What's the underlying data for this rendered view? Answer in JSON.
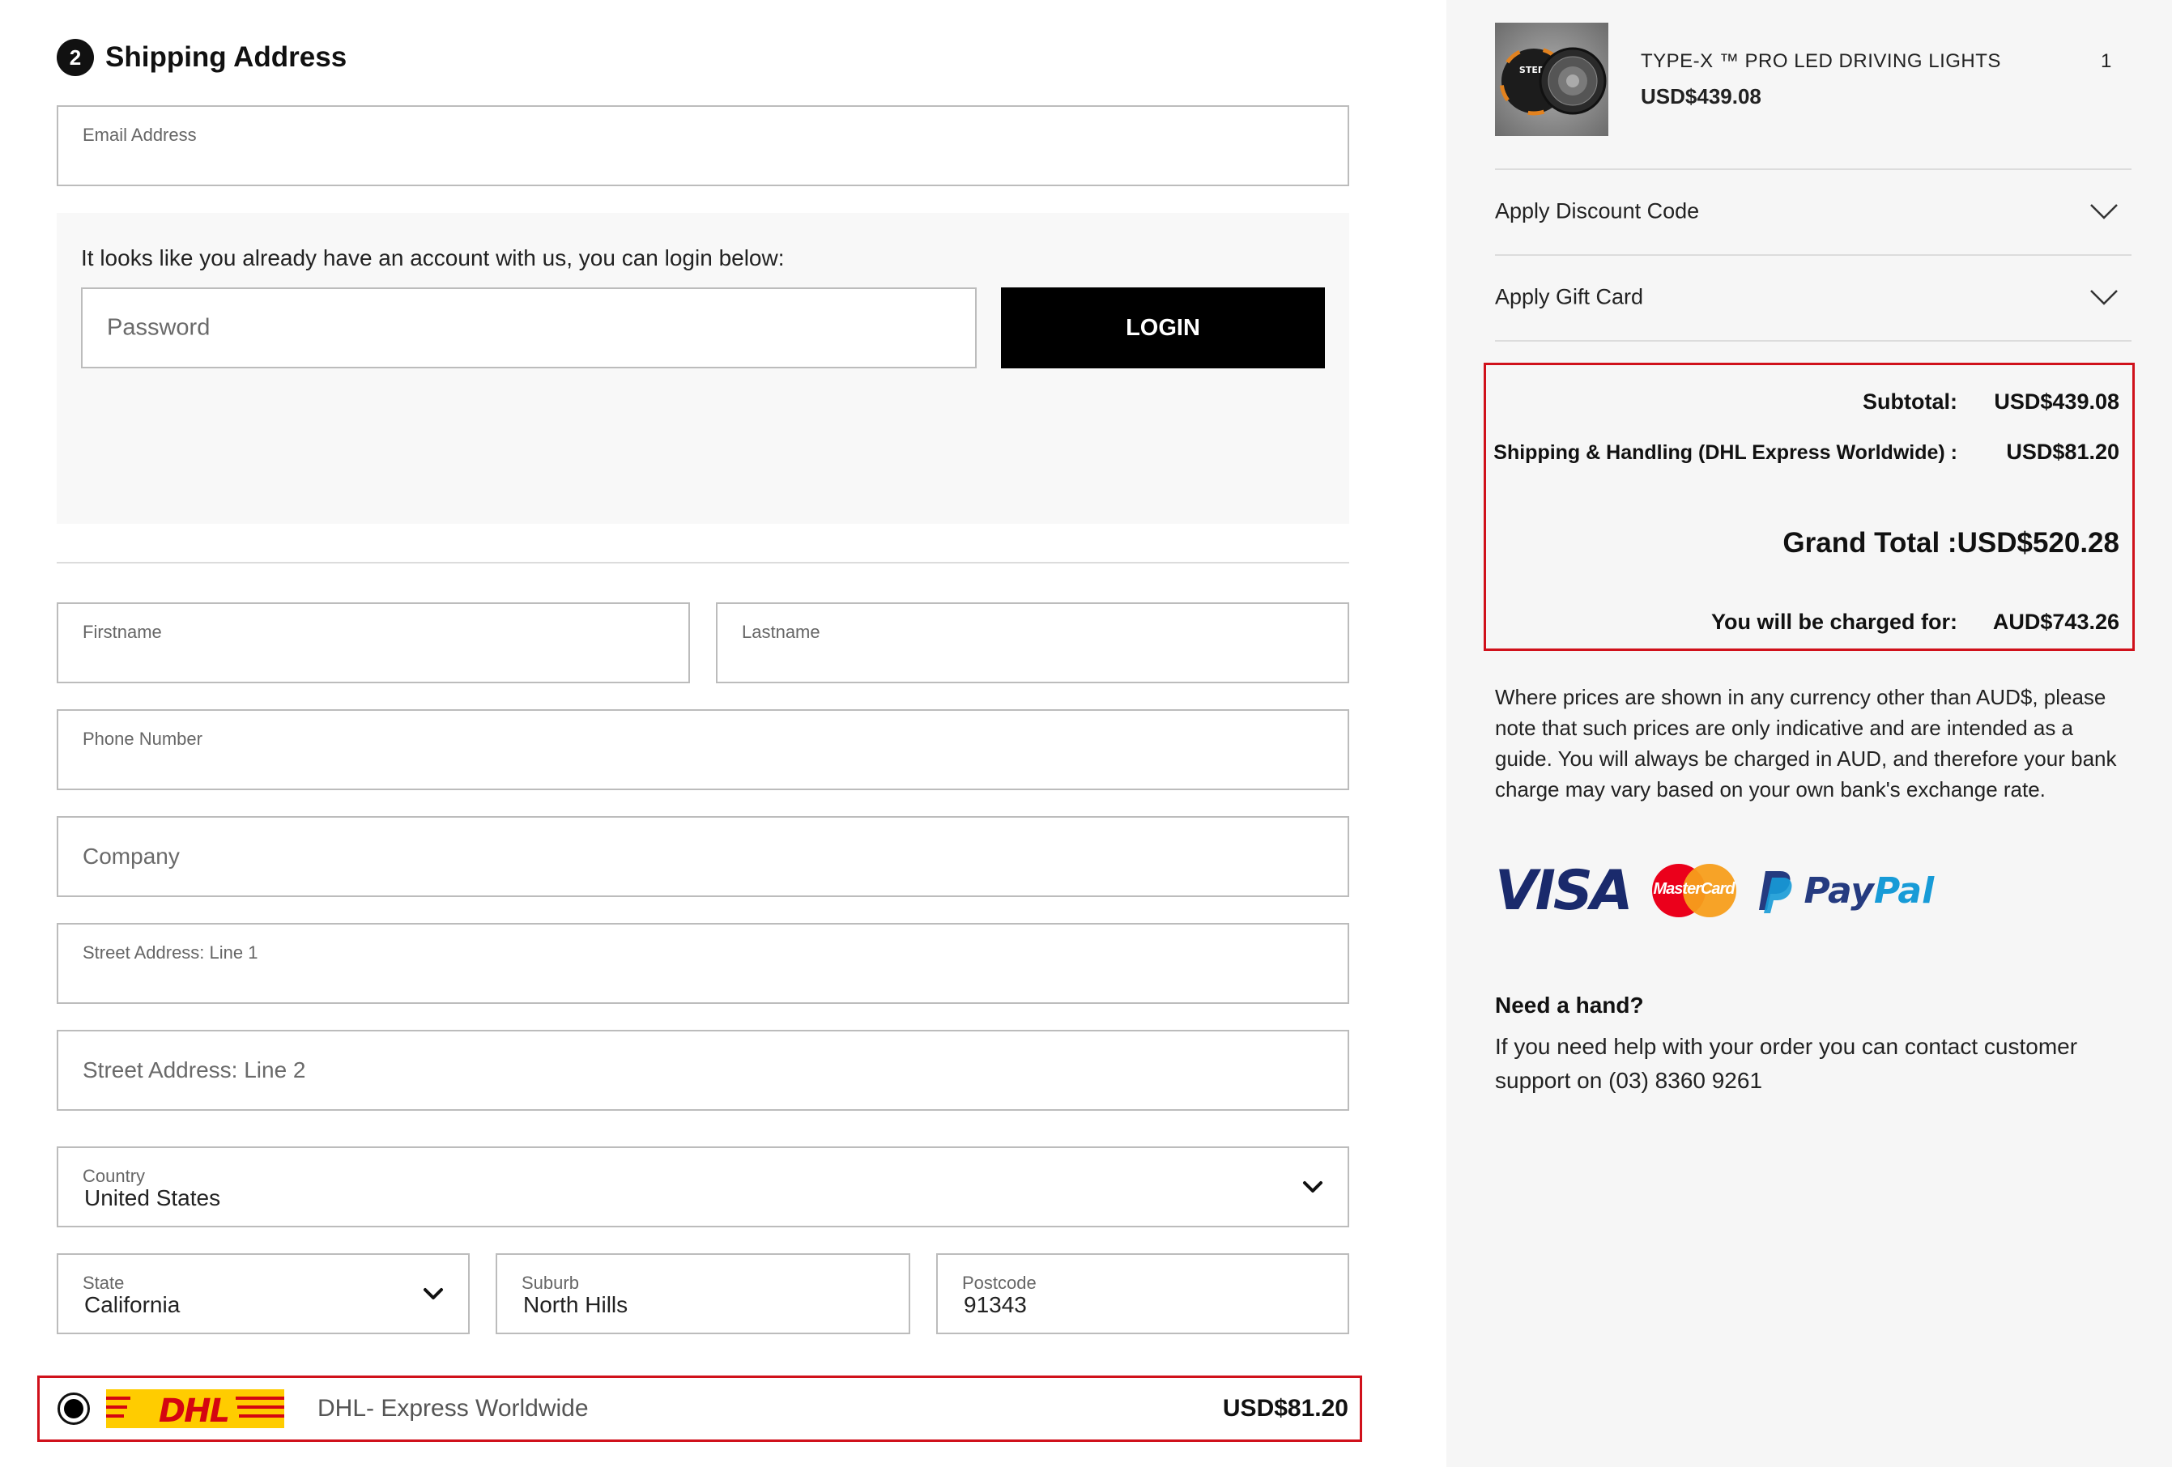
{
  "shipping": {
    "step_number": "2",
    "title": "Shipping Address",
    "email_label": "Email Address",
    "account_message": "It looks like you already have an account with us, you can login below:",
    "password_placeholder": "Password",
    "login_label": "LOGIN",
    "firstname_label": "Firstname",
    "lastname_label": "Lastname",
    "phone_label": "Phone Number",
    "company_placeholder": "Company",
    "street1_label": "Street Address: Line 1",
    "street2_placeholder": "Street Address: Line 2",
    "country_label": "Country",
    "country_value": "United States",
    "state_label": "State",
    "state_value": "California",
    "suburb_label": "Suburb",
    "suburb_value": "North Hills",
    "postcode_label": "Postcode",
    "postcode_value": "91343",
    "option": {
      "carrier_logo_text": "DHL",
      "name": "DHL- Express Worldwide",
      "price": "USD$81.20",
      "selected": true
    }
  },
  "cart": {
    "product": {
      "name": "TYPE-X ™ PRO LED DRIVING LIGHTS",
      "price": "USD$439.08",
      "qty": "1",
      "image_brand_text": "STEDI"
    },
    "discount_label": "Apply Discount Code",
    "giftcard_label": "Apply Gift Card",
    "totals": {
      "subtotal_label": "Subtotal:",
      "subtotal_value": "USD$439.08",
      "shipping_label": "Shipping & Handling (DHL Express Worldwide) :",
      "shipping_value": "USD$81.20",
      "grand_label": "Grand Total :",
      "grand_value": "USD$520.28",
      "charged_label": "You will be charged for:",
      "charged_value": "AUD$743.26"
    },
    "disclaimer": "Where prices are shown in any currency other than AUD$, please note that such prices are only indicative and are intended as a guide. You will always be charged in AUD, and therefore your bank charge may vary based on your own bank's exchange rate.",
    "payment": {
      "visa": "VISA",
      "mastercard": "MasterCard",
      "paypal_pay": "Pay",
      "paypal_pal": "Pal"
    },
    "help_title": "Need a hand?",
    "help_text": "If you need help with your order you can contact customer support on (03) 8360 9261"
  },
  "colors": {
    "highlight": "#d0111b",
    "dhl_yellow": "#ffcc00",
    "dhl_red": "#d40511",
    "button": "#000000"
  }
}
